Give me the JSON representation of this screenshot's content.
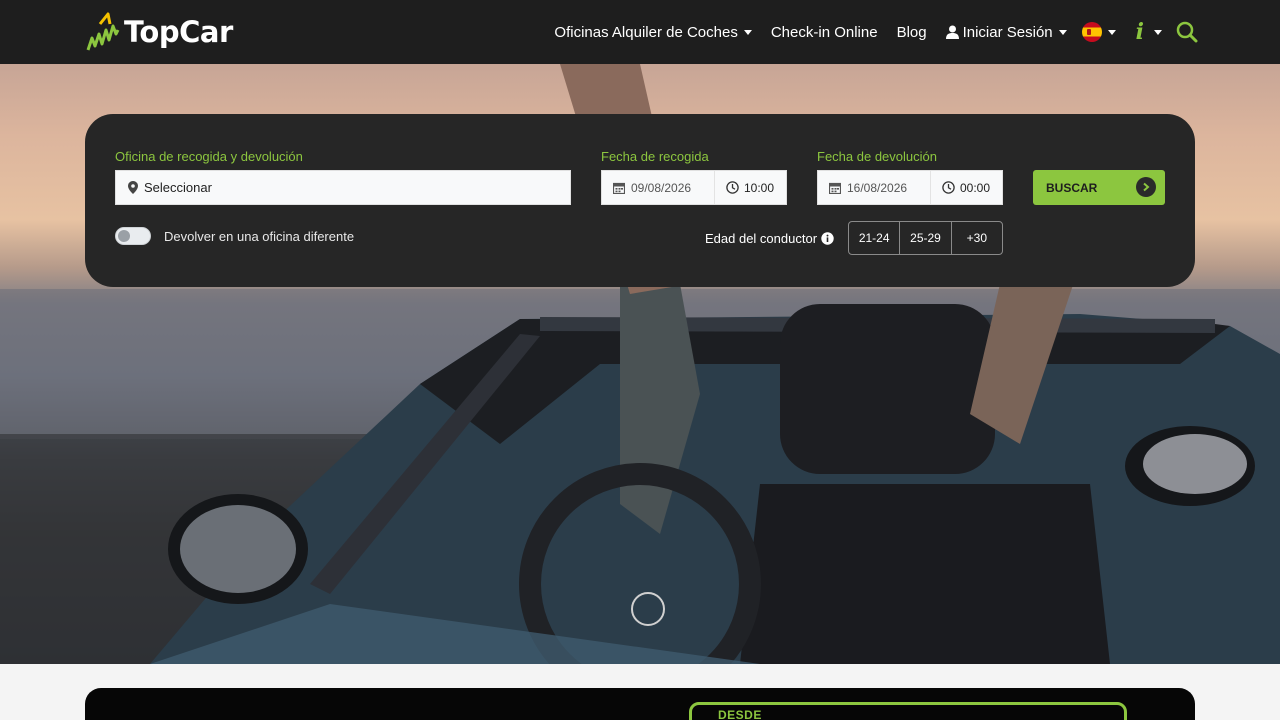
{
  "brand": {
    "name": "TopCar",
    "accent": "#8cc63f",
    "nav_bg": "#1e1e1e",
    "panel_bg": "#262626"
  },
  "nav": {
    "offices": "Oficinas Alquiler de Coches",
    "checkin": "Check-in Online",
    "blog": "Blog",
    "login": "Iniciar Sesión",
    "language_icon": "spain-flag-icon",
    "info_icon": "info-icon",
    "search_icon": "search-icon"
  },
  "search": {
    "office_label": "Oficina de recogida y devolución",
    "office_value": "Seleccionar",
    "pickup_label": "Fecha de recogida",
    "pickup_date": "09/08/2026",
    "pickup_time": "10:00",
    "return_label": "Fecha de devolución",
    "return_date": "16/08/2026",
    "return_time": "00:00",
    "button": "BUSCAR",
    "different_office_label": "Devolver en una oficina diferente",
    "different_office_enabled": false,
    "age_label": "Edad del conductor",
    "age_options": [
      "21-24",
      "25-29",
      "+30"
    ]
  },
  "promo": {
    "text": "DESDE"
  }
}
